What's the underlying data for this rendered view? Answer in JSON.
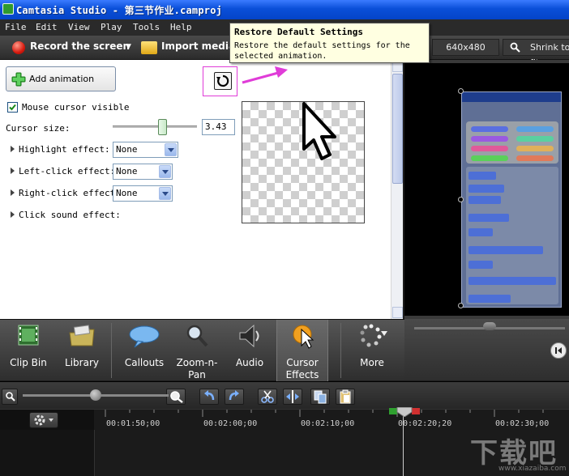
{
  "window": {
    "title": "Camtasia Studio - 第三节作业.camproj"
  },
  "menu": [
    "File",
    "Edit",
    "View",
    "Play",
    "Tools",
    "Help"
  ],
  "toolbar": {
    "record_label": "Record the screen",
    "import_label": "Import media",
    "resolution": "640x480",
    "shrink_label": "Shrink to fit"
  },
  "tooltip": {
    "title": "Restore Default Settings",
    "body_line1": "Restore the default settings for the",
    "body_line2": "selected animation."
  },
  "cursor_panel": {
    "add_animation_label": "Add animation",
    "mouse_visible_label": "Mouse cursor visible",
    "mouse_visible_checked": true,
    "cursor_size_label": "Cursor size:",
    "cursor_size_value": "3.43",
    "cursor_size_fraction": 0.57,
    "highlight_label": "Highlight effect:",
    "highlight_value": "None",
    "leftclick_label": "Left-click effect:",
    "leftclick_value": "None",
    "rightclick_label": "Right-click effect",
    "rightclick_value": "None",
    "clicksound_label": "Click sound effect:"
  },
  "tabs": [
    {
      "label": "Clip Bin"
    },
    {
      "label": "Library"
    },
    {
      "label": "Callouts"
    },
    {
      "label1": "Zoom-n-",
      "label2": "Pan"
    },
    {
      "label": "Audio"
    },
    {
      "label1": "Cursor",
      "label2": "Effects",
      "active": true
    },
    {
      "label": "More"
    }
  ],
  "timeline": {
    "ticks": [
      "00:01:50;00",
      "00:02:00;00",
      "00:02:10;00",
      "00:02:20;20",
      "00:02:30;00"
    ]
  },
  "watermark": {
    "line1": "下载吧",
    "line2": "www.xiazaiba.com"
  },
  "colors": {
    "accent_magenta": "#e03cd8",
    "title_blue": "#0a4fd8",
    "tooltip_bg": "#ffffe1"
  }
}
